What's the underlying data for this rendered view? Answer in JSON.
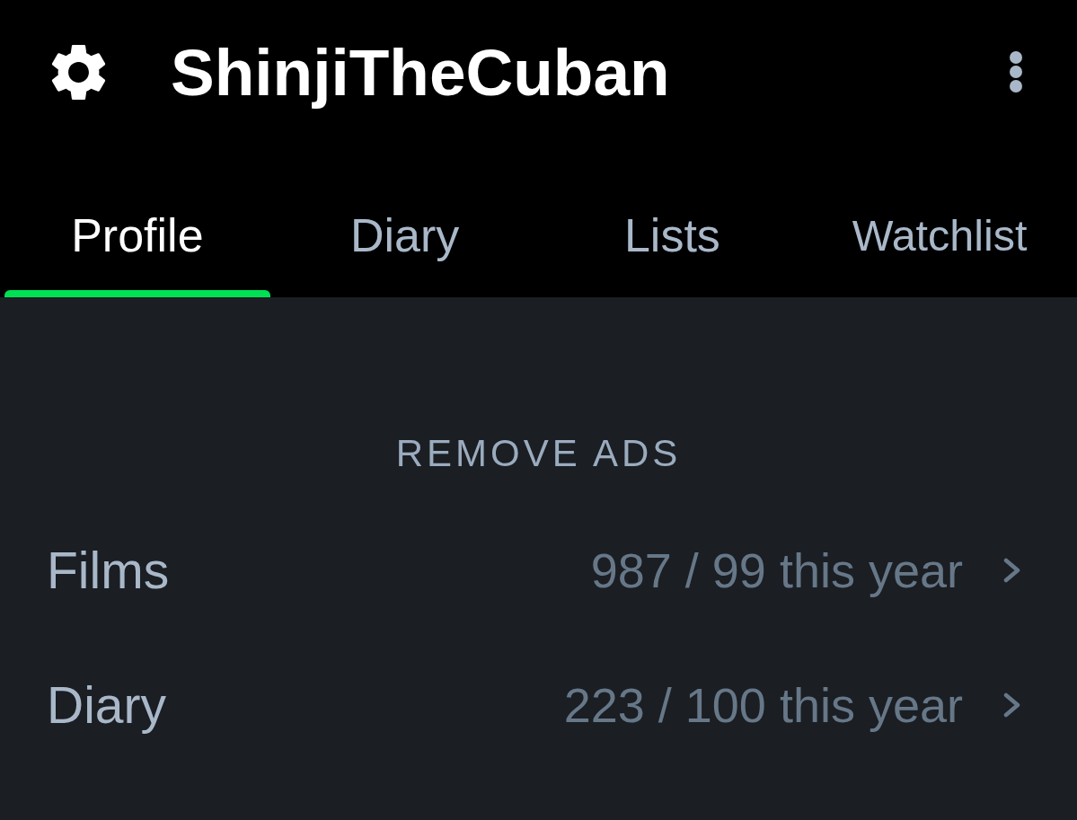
{
  "header": {
    "title": "ShinjiTheCuban"
  },
  "tabs": [
    {
      "label": "Profile",
      "selected": true
    },
    {
      "label": "Diary",
      "selected": false
    },
    {
      "label": "Lists",
      "selected": false
    },
    {
      "label": "Watchlist",
      "selected": false
    }
  ],
  "remove_ads": {
    "label": "REMOVE ADS"
  },
  "stats": [
    {
      "label": "Films",
      "value": "987 / 99 this year"
    },
    {
      "label": "Diary",
      "value": "223 / 100 this year"
    }
  ]
}
